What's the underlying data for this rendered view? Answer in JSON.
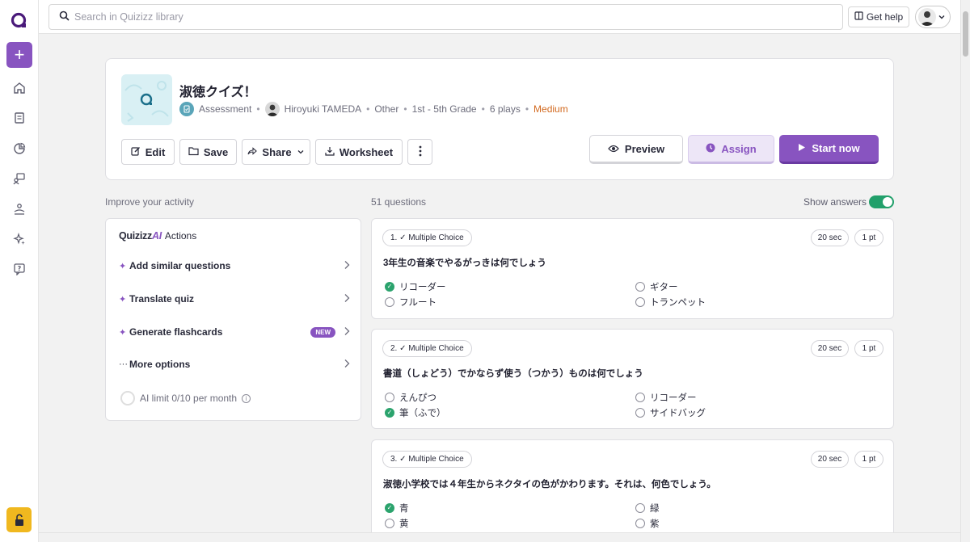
{
  "search": {
    "placeholder": "Search in Quizizz library"
  },
  "header": {
    "help_label": "Get help"
  },
  "quiz": {
    "title": "淑徳クイズ！",
    "type": "Assessment",
    "author": "Hiroyuki TAMEDA",
    "subject": "Other",
    "grade": "1st - 5th Grade",
    "plays": "6 plays",
    "difficulty": "Medium",
    "difficulty_color": "#d2691e"
  },
  "actions": {
    "edit": "Edit",
    "save": "Save",
    "share": "Share",
    "worksheet": "Worksheet",
    "preview": "Preview",
    "assign": "Assign",
    "start": "Start now"
  },
  "improve": {
    "heading": "Improve your activity",
    "brand": "Quizizz",
    "brand_ai": "AI",
    "brand_suffix": "Actions",
    "items": [
      {
        "label": "Add similar questions",
        "icon": "sparkle-icon"
      },
      {
        "label": "Translate quiz",
        "icon": "sparkle-icon"
      },
      {
        "label": "Generate flashcards",
        "icon": "sparkle-icon",
        "badge": "NEW"
      },
      {
        "label": "More options",
        "icon": "ellipsis-icon"
      }
    ],
    "limit": "AI limit 0/10 per month"
  },
  "questions_header": {
    "count": "51 questions",
    "show_answers_label": "Show answers",
    "show_answers_on": true
  },
  "questions": [
    {
      "type": "1. ✓ Multiple Choice",
      "time": "20 sec",
      "points": "1 pt",
      "text": "3年生の音楽でやるがっきは何でしょう",
      "options": [
        {
          "text": "リコーダー",
          "correct": true
        },
        {
          "text": "ギター",
          "correct": false
        },
        {
          "text": "フルート",
          "correct": false
        },
        {
          "text": "トランペット",
          "correct": false
        }
      ]
    },
    {
      "type": "2. ✓ Multiple Choice",
      "time": "20 sec",
      "points": "1 pt",
      "text": "書道（しょどう）でかならず使う（つかう）ものは何でしょう",
      "options": [
        {
          "text": "えんぴつ",
          "correct": false
        },
        {
          "text": "リコーダー",
          "correct": false
        },
        {
          "text": "筆（ふで）",
          "correct": true
        },
        {
          "text": "サイドバッグ",
          "correct": false
        }
      ]
    },
    {
      "type": "3. ✓ Multiple Choice",
      "time": "20 sec",
      "points": "1 pt",
      "text": "淑徳小学校では４年生からネクタイの色がかわります。それは、何色でしょう。",
      "options": [
        {
          "text": "青",
          "correct": true
        },
        {
          "text": "緑",
          "correct": false
        },
        {
          "text": "黄",
          "correct": false
        },
        {
          "text": "紫",
          "correct": false
        }
      ]
    }
  ],
  "colors": {
    "brand": "#8854c0",
    "correct": "#2ba36d",
    "toggle_on": "#22a06b"
  }
}
